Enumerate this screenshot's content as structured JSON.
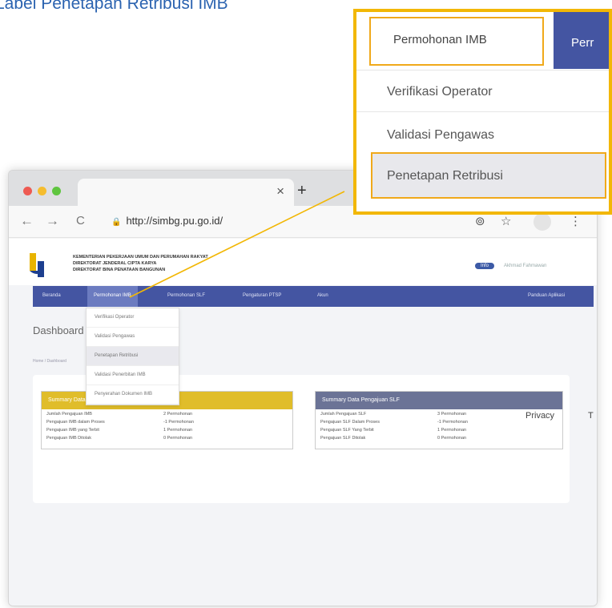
{
  "heading": "Label Penetapan Retribusi IMB",
  "browser": {
    "new_tab": "+",
    "tab_close": "×",
    "url": "http://simbg.pu.go.id/",
    "nav_back": "←",
    "nav_forward": "→",
    "nav_reload": "C",
    "lock": "🔒",
    "extension_icon": "⊚",
    "star_icon": "☆",
    "menu_icon": "⋮"
  },
  "site": {
    "org_line1": "KEMENTERIAN PEKERJAAN UMUM DAN PERUMAHAN RAKYAT",
    "org_line2": "DIREKTORAT JENDERAL CIPTA KARYA",
    "org_line3": "DIREKTORAT BINA PENATAAN BANGUNAN",
    "info_pill": "Info",
    "header_text": "Akhmad Fahmawan",
    "nav": {
      "beranda": "Beranda",
      "permohonan_imb": "Permohonan IMB",
      "permohonan_slf": "Permohonan SLF",
      "pengaturan": "Pengaturan PTSP",
      "akun": "Akun",
      "panduan": "Panduan Aplikasi"
    },
    "dashboard_title": "Dashboard",
    "breadcrumb": "Home / Dashboard",
    "dropdown": [
      "Verifikasi Operator",
      "Validasi Pengawas",
      "Penetapan Retribusi",
      "Validasi Penerbitan IMB",
      "Penyerahan Dokumen IMB"
    ],
    "summary_imb": {
      "title": "Summary Data Pengajuan IMB",
      "rows": [
        {
          "k": "Jumlah Pengajuan IMB",
          "v": "2 Permohonan"
        },
        {
          "k": "Pengajuan IMB dalam Proses",
          "v": "-1 Permohonan"
        },
        {
          "k": "Pengajuan IMB yang Terbit",
          "v": "1 Permohonan"
        },
        {
          "k": "Pengajuan IMB Ditolak",
          "v": "0 Permohonan"
        }
      ]
    },
    "summary_slf": {
      "title": "Summary Data Pengajuan SLF",
      "rows": [
        {
          "k": "Jumlah Pengajuan SLF",
          "v": "3 Permohonan"
        },
        {
          "k": "Pengajuan SLF Dalam Proses",
          "v": "-1 Permohonan"
        },
        {
          "k": "Pengajuan SLF Yang Terbit",
          "v": "1 Permohonan"
        },
        {
          "k": "Pengajuan SLF Ditolak",
          "v": "0 Permohonan"
        }
      ]
    },
    "footer_privacy": "Privacy",
    "footer_t": "T"
  },
  "callout": {
    "top_item": "Permohonan IMB",
    "per_tab": "Perr",
    "items": [
      "Verifikasi Operator",
      "Validasi Pengawas"
    ],
    "highlight": "Penetapan Retribusi"
  },
  "colors": {
    "accent_blue": "#4455a2",
    "highlight_yellow": "#f2b705",
    "imb_header": "#e0bd2a",
    "slf_header": "#6b7396"
  }
}
